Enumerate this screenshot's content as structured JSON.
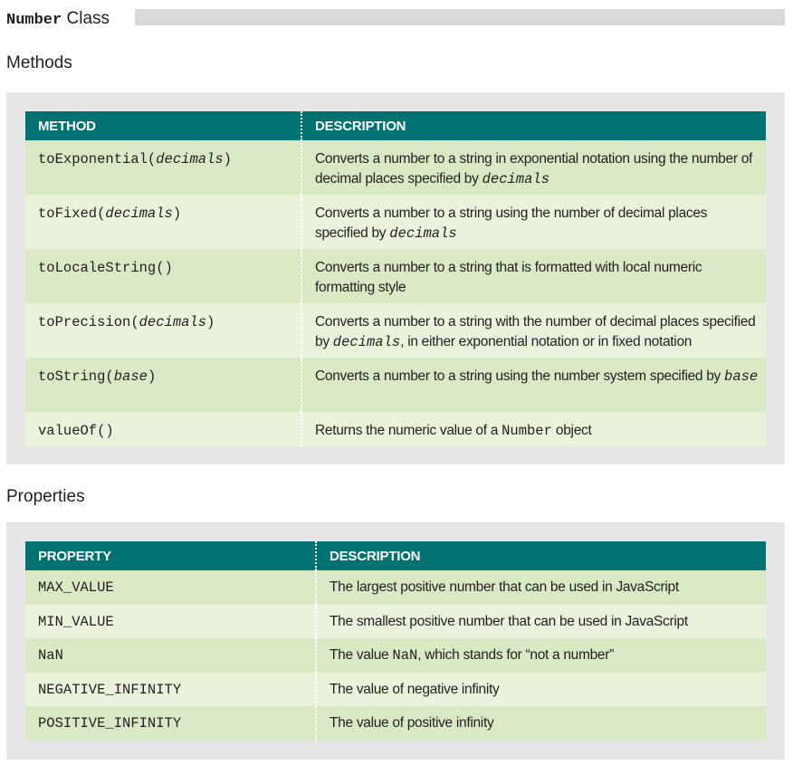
{
  "title": {
    "code": "Number",
    "word": "Class"
  },
  "methods_heading": "Methods",
  "methods": {
    "headers": [
      "METHOD",
      "DESCRIPTION"
    ],
    "rows": [
      {
        "name": "toExponential(",
        "arg": "decimals",
        "close": ")",
        "desc_a": "Converts a number to a string in exponential notation using the number of decimal places specified by ",
        "desc_code": "decimals",
        "desc_b": ""
      },
      {
        "name": "toFixed(",
        "arg": "decimals",
        "close": ")",
        "desc_a": "Converts a number to a string using the number of decimal places specified by ",
        "desc_code": "decimals",
        "desc_b": ""
      },
      {
        "name": "toLocaleString()",
        "arg": "",
        "close": "",
        "desc_a": "Converts a number to a string that is formatted with local numeric formatting style",
        "desc_code": "",
        "desc_b": ""
      },
      {
        "name": "toPrecision(",
        "arg": "decimals",
        "close": ")",
        "desc_a": "Converts a number to a string with the number of decimal places specified by ",
        "desc_code": "decimals",
        "desc_b": ", in either exponential notation or in fixed notation"
      },
      {
        "name": "toString(",
        "arg": "base",
        "close": ")",
        "desc_a": "Converts a number to a string using the number system specified by ",
        "desc_code": "base",
        "desc_b": ""
      },
      {
        "name": "valueOf()",
        "arg": "",
        "close": "",
        "desc_a": "Returns the numeric value of a ",
        "desc_code": "Number",
        "desc_b": " object",
        "desc_code_upright": true
      }
    ]
  },
  "properties_heading": "Properties",
  "properties": {
    "headers": [
      "PROPERTY",
      "DESCRIPTION"
    ],
    "rows": [
      {
        "name": "MAX_VALUE",
        "desc_a": "The largest positive number that can be used in JavaScript",
        "desc_code": "",
        "desc_b": ""
      },
      {
        "name": "MIN_VALUE",
        "desc_a": "The smallest positive number that can be used in JavaScript",
        "desc_code": "",
        "desc_b": ""
      },
      {
        "name": "NaN",
        "desc_a": "The value ",
        "desc_code": "NaN",
        "desc_b": ", which stands for “not a number”"
      },
      {
        "name": "NEGATIVE_INFINITY",
        "desc_a": "The value of negative infinity",
        "desc_code": "",
        "desc_b": ""
      },
      {
        "name": "POSITIVE_INFINITY",
        "desc_a": "The value of positive infinity",
        "desc_code": "",
        "desc_b": ""
      }
    ]
  },
  "colors": {
    "header_teal": "#007272",
    "row_dark": "#d8e9c4",
    "row_light": "#e9f2da",
    "panel_gray": "#e6e6e6",
    "title_bar": "#d9d9d9"
  }
}
